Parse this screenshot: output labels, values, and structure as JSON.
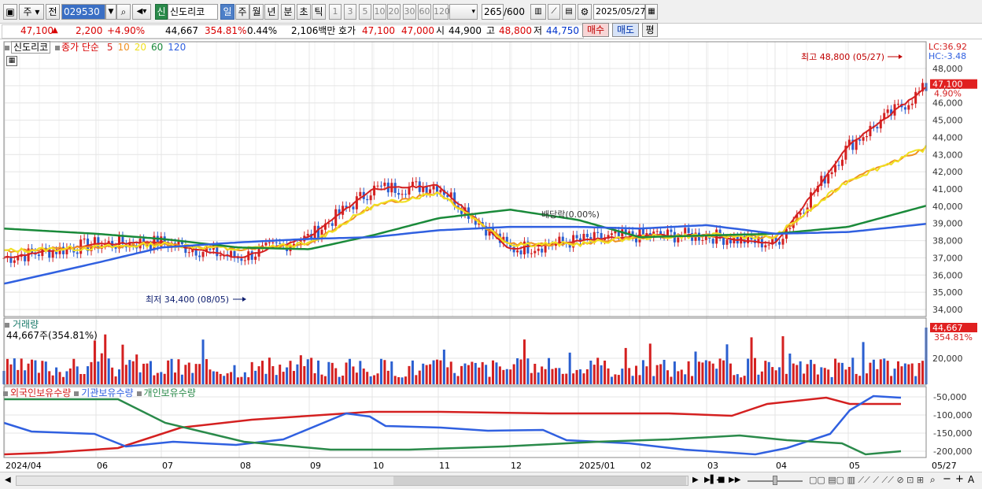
{
  "toolbar": {
    "market_label": "주",
    "prev_label": "전",
    "stock_code": "029530",
    "new_badge": "신",
    "stock_name": "신도리코",
    "periods": [
      "일",
      "주",
      "월",
      "년",
      "분",
      "초",
      "틱"
    ],
    "selected_period": "일",
    "intervals": [
      "1",
      "3",
      "5",
      "10",
      "20",
      "30",
      "60",
      "120"
    ],
    "count_value": "265",
    "count_max": "/600",
    "date_value": "2025/05/27"
  },
  "quote_bar": {
    "price": "47,100",
    "change": "2,200",
    "change_pct": "+4.90%",
    "volume": "44,667",
    "volume_ratio": "354.81%",
    "turnover": "0.44%",
    "amount": "2,106백만",
    "ask_label": "호가",
    "ask": "47,100",
    "bid": "47,000",
    "open_label": "시",
    "open": "44,900",
    "high_label": "고",
    "high": "48,800",
    "low_label": "저",
    "low": "44,750",
    "buy_label": "매수",
    "sell_label": "매도",
    "eval_label": "평"
  },
  "price_pane": {
    "legend_name": "신도리코",
    "legend_series": "종가 단순",
    "ma_labels": [
      "5",
      "10",
      "20",
      "60",
      "120"
    ],
    "ma_colors": [
      "#d42020",
      "#f09020",
      "#f0e020",
      "#1a8a3a",
      "#3060e0"
    ],
    "lc": "LC:36.92",
    "hc": "HC:-3.48",
    "current_price_tag": "47,100",
    "current_pct_tag": "4.90%",
    "high_annotation": "최고 48,800 (05/27)",
    "low_annotation": "최저 34,400 (08/05)",
    "dividend_annotation": "배당락(0.00%)",
    "y_ticks": [
      "48,000",
      "47,000",
      "46,000",
      "45,000",
      "44,000",
      "43,000",
      "42,000",
      "41,000",
      "40,000",
      "39,000",
      "38,000",
      "37,000",
      "36,000",
      "35,000",
      "34,000"
    ]
  },
  "volume_pane": {
    "title": "거래량",
    "value_text": "44,667주(354.81%)",
    "tag_value": "44,667",
    "tag_pct": "354.81%",
    "y_ticks": [
      "20,000"
    ]
  },
  "holdings_pane": {
    "series": [
      {
        "name": "외국인보유수량",
        "color": "#d42020"
      },
      {
        "name": "기관보유수량",
        "color": "#3060e0"
      },
      {
        "name": "개인보유수량",
        "color": "#2a8a4a"
      }
    ],
    "y_ticks": [
      "-50,000",
      "-100,000",
      "-150,000",
      "-200,000"
    ]
  },
  "x_axis": {
    "labels": [
      "2024/04",
      "06",
      "07",
      "08",
      "09",
      "10",
      "11",
      "12",
      "2025/01",
      "02",
      "03",
      "04",
      "05",
      "05/27"
    ]
  },
  "chart_data": {
    "type": "line",
    "title": "",
    "xlabel": "",
    "ylabel": "",
    "ylim": [
      34000,
      48800
    ],
    "x": [
      "2024/04",
      "06",
      "07",
      "08",
      "09",
      "10",
      "11",
      "12",
      "2025/01",
      "02",
      "03",
      "04",
      "05",
      "05/27"
    ],
    "series": [
      {
        "name": "종가",
        "values": [
          37000,
          37800,
          37900,
          37000,
          38200,
          41000,
          41200,
          37500,
          38000,
          38300,
          38300,
          37800,
          43500,
          47100
        ]
      },
      {
        "name": "20",
        "values": [
          37400,
          37600,
          37800,
          37500,
          37800,
          40000,
          40800,
          37800,
          37800,
          38200,
          38300,
          38200,
          41500,
          43500
        ]
      },
      {
        "name": "60",
        "values": [
          38700,
          38400,
          38100,
          37600,
          37500,
          38300,
          39300,
          39800,
          39200,
          38200,
          38300,
          38400,
          38800,
          40100
        ]
      },
      {
        "name": "120",
        "values": [
          35500,
          36700,
          37600,
          37900,
          38100,
          38200,
          38600,
          38800,
          38800,
          38700,
          38900,
          38400,
          38500,
          39000
        ]
      }
    ],
    "high": {
      "value": 48800,
      "date": "05/27"
    },
    "low": {
      "value": 34400,
      "date": "08/05"
    },
    "volume": {
      "last": 44667,
      "ratio": "354.81%"
    }
  }
}
